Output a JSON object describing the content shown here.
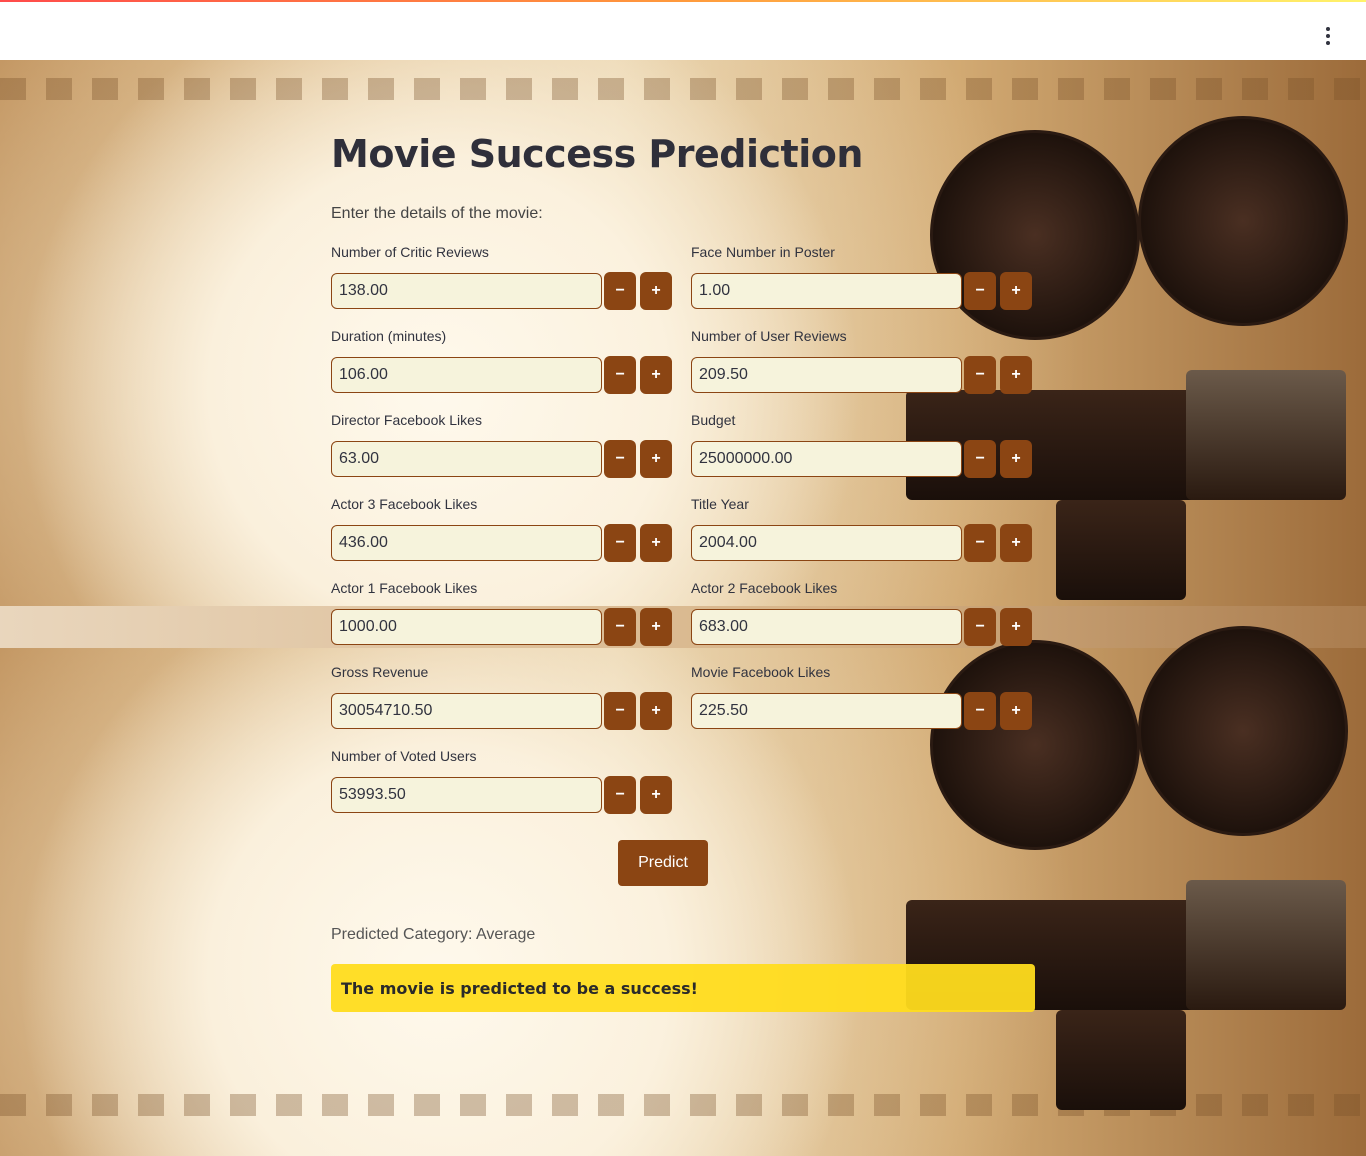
{
  "app": {
    "title": "Movie Success Prediction",
    "subtitle": "Enter the details of the movie:",
    "menu_icon": "vertical-ellipsis-icon"
  },
  "fields": {
    "critic_reviews": {
      "label": "Number of Critic Reviews",
      "value": "138.00"
    },
    "face_number": {
      "label": "Face Number in Poster",
      "value": "1.00"
    },
    "duration": {
      "label": "Duration (minutes)",
      "value": "106.00"
    },
    "user_reviews": {
      "label": "Number of User Reviews",
      "value": "209.50"
    },
    "director_likes": {
      "label": "Director Facebook Likes",
      "value": "63.00"
    },
    "budget": {
      "label": "Budget",
      "value": "25000000.00"
    },
    "actor3_likes": {
      "label": "Actor 3 Facebook Likes",
      "value": "436.00"
    },
    "title_year": {
      "label": "Title Year",
      "value": "2004.00"
    },
    "actor1_likes": {
      "label": "Actor 1 Facebook Likes",
      "value": "1000.00"
    },
    "actor2_likes": {
      "label": "Actor 2 Facebook Likes",
      "value": "683.00"
    },
    "gross": {
      "label": "Gross Revenue",
      "value": "30054710.50"
    },
    "movie_likes": {
      "label": "Movie Facebook Likes",
      "value": "225.50"
    },
    "voted_users": {
      "label": "Number of Voted Users",
      "value": "53993.50"
    }
  },
  "stepper": {
    "minus": "−",
    "plus": "+"
  },
  "predict_button": "Predict",
  "result": {
    "category": "Predicted Category: Average",
    "message": "The movie is predicted to be a success!"
  },
  "colors": {
    "accent": "#8b4513",
    "input_bg": "#f6f3dc",
    "banner": "#ffdc1e"
  }
}
